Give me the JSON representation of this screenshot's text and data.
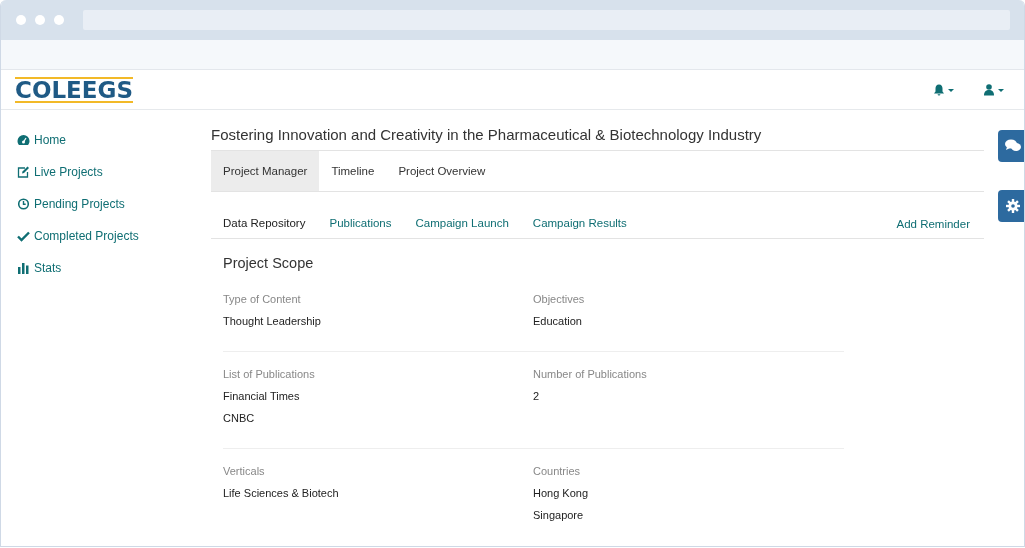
{
  "logo": {
    "text": "COLEEGS"
  },
  "sidebar": {
    "items": [
      {
        "label": "Home",
        "selected": false
      },
      {
        "label": "Live Projects",
        "selected": false
      },
      {
        "label": "Pending Projects",
        "selected": false
      },
      {
        "label": "Completed Projects",
        "selected": false
      },
      {
        "label": "Stats",
        "selected": false
      }
    ]
  },
  "project": {
    "title": "Fostering Innovation and Creativity in the Pharmaceutical & Biotechnology Industry"
  },
  "tabs": [
    {
      "label": "Project Manager",
      "selected": true
    },
    {
      "label": "Timeline",
      "selected": false
    },
    {
      "label": "Project Overview",
      "selected": false
    }
  ],
  "subtabs": [
    {
      "label": "Data Repository",
      "selected": true
    },
    {
      "label": "Publications",
      "selected": false
    },
    {
      "label": "Campaign Launch",
      "selected": false
    },
    {
      "label": "Campaign Results",
      "selected": false
    }
  ],
  "add_reminder": "Add Reminder",
  "section": {
    "title": "Project Scope",
    "rows": [
      [
        {
          "label": "Type of Content",
          "values": [
            "Thought Leadership"
          ]
        },
        {
          "label": "Objectives",
          "values": [
            "Education"
          ]
        }
      ],
      [
        {
          "label": "List of Publications",
          "values": [
            "Financial Times",
            "CNBC"
          ]
        },
        {
          "label": "Number of Publications",
          "values": [
            "2"
          ]
        }
      ],
      [
        {
          "label": "Verticals",
          "values": [
            "Life Sciences & Biotech"
          ]
        },
        {
          "label": "Countries",
          "values": [
            "Hong Kong",
            "Singapore"
          ]
        }
      ]
    ]
  }
}
